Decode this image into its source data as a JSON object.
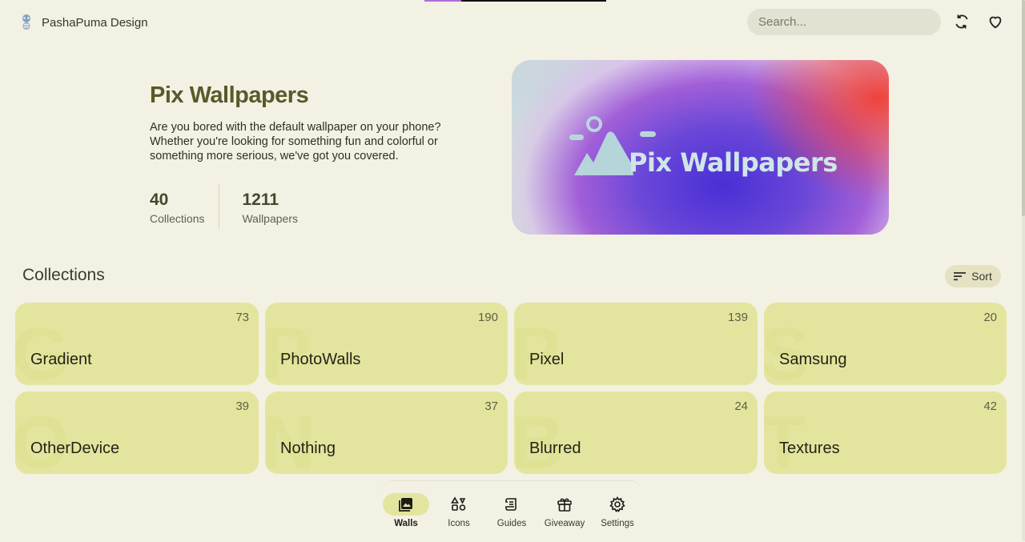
{
  "brand": {
    "name": "PashaPuma Design",
    "logo_icon": "raccoon-logo-icon"
  },
  "header": {
    "search_placeholder": "Search...",
    "icons": [
      "sync-icon",
      "heart-icon"
    ]
  },
  "hero": {
    "title": "Pix Wallpapers",
    "description": "Are you bored with the default wallpaper on your phone? Whether you're looking for something fun and colorful or something more serious, we've got you covered.",
    "stats": [
      {
        "value": "40",
        "label": "Collections"
      },
      {
        "value": "1211",
        "label": "Wallpapers"
      }
    ],
    "banner_text": "Pix Wallpapers"
  },
  "collections": {
    "title": "Collections",
    "sort_label": "Sort",
    "items": [
      {
        "name": "Gradient",
        "count": "73",
        "letter": "G"
      },
      {
        "name": "PhotoWalls",
        "count": "190",
        "letter": "P"
      },
      {
        "name": "Pixel",
        "count": "139",
        "letter": "P"
      },
      {
        "name": "Samsung",
        "count": "20",
        "letter": "S"
      },
      {
        "name": "OtherDevice",
        "count": "39",
        "letter": "O"
      },
      {
        "name": "Nothing",
        "count": "37",
        "letter": "N"
      },
      {
        "name": "Blurred",
        "count": "24",
        "letter": "B"
      },
      {
        "name": "Textures",
        "count": "42",
        "letter": "T"
      }
    ]
  },
  "bottom_nav": {
    "active": "Walls",
    "items": [
      {
        "label": "Walls",
        "icon": "wallpaper-icon"
      },
      {
        "label": "Icons",
        "icon": "shapes-icon"
      },
      {
        "label": "Guides",
        "icon": "scroll-icon"
      },
      {
        "label": "Giveaway",
        "icon": "gift-icon"
      },
      {
        "label": "Settings",
        "icon": "gear-icon"
      }
    ]
  },
  "colors": {
    "background": "#f3f1e3",
    "card": "#e3e59e",
    "title_olive": "#59592a"
  }
}
